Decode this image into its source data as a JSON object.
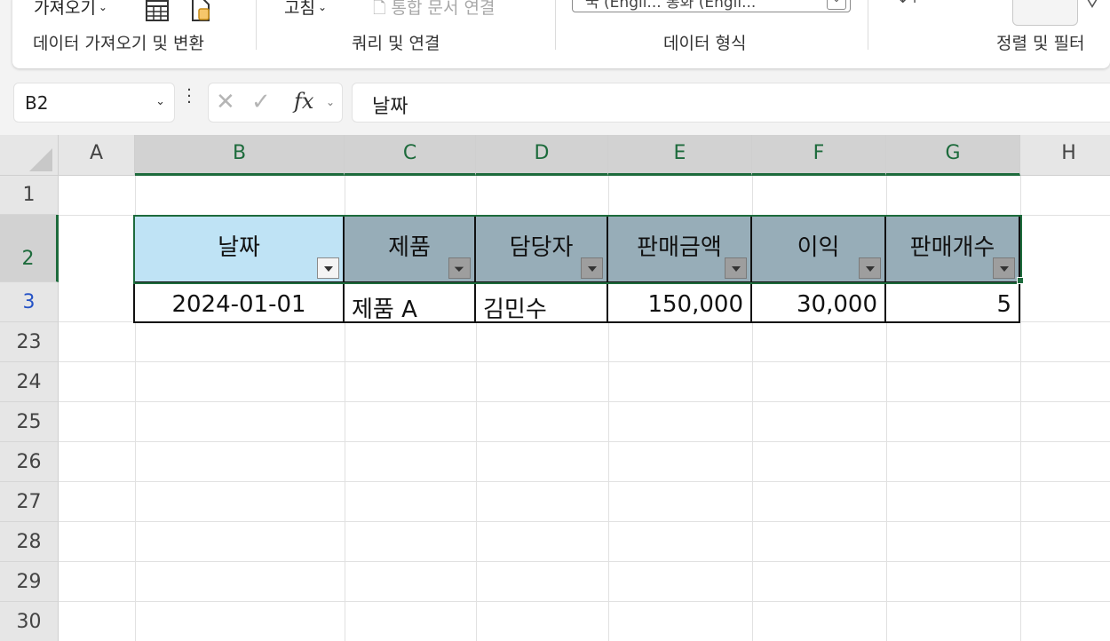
{
  "ribbon": {
    "get_data_label": "가져오기",
    "refresh_label": "고침",
    "edit_links_label": "통합 문서 연결",
    "data_type_combo_text": "국 (Engli...  통화 (Engli...",
    "groups": {
      "get_transform": "데이터 가져오기 및 변환",
      "queries_connections": "쿼리 및 연결",
      "data_types": "데이터 형식",
      "sort_filter": "정렬 및 필터"
    }
  },
  "formula_bar": {
    "name_box": "B2",
    "fx_label": "fx",
    "formula": "날짜"
  },
  "grid": {
    "columns": [
      "A",
      "B",
      "C",
      "D",
      "E",
      "F",
      "G",
      "H"
    ],
    "rows": [
      "1",
      "2",
      "3",
      "23",
      "24",
      "25",
      "26",
      "27",
      "28",
      "29",
      "30"
    ],
    "selected_columns": [
      "B",
      "C",
      "D",
      "E",
      "F",
      "G"
    ],
    "selected_row": "2",
    "filtered_row_number_color": "#2553c6"
  },
  "table": {
    "headers": [
      "날짜",
      "제품",
      "담당자",
      "판매금액",
      "이익",
      "판매개수"
    ],
    "row": [
      "2024-01-01",
      "제품 A",
      "김민수",
      "150,000",
      "30,000",
      "5"
    ],
    "header_color": "#97adb8",
    "active_header_color": "#bfe3f5",
    "filtered_column": "제품"
  },
  "colors": {
    "selection": "#1d6b3c"
  }
}
